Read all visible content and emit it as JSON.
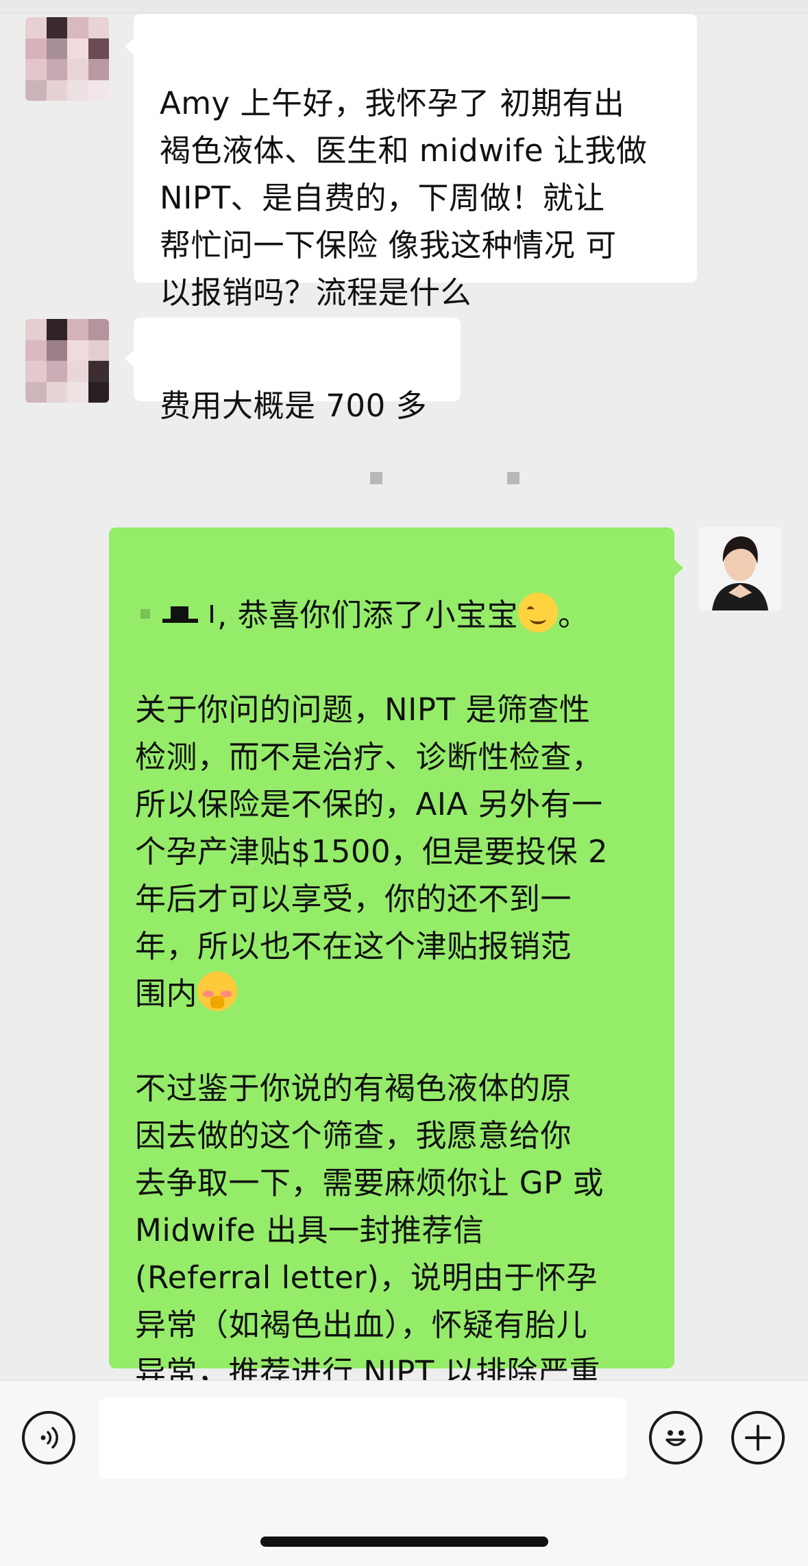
{
  "chat": {
    "messages": [
      {
        "sender": "other",
        "text": "Amy 上午好，我怀孕了 初期有出\n褐色液体、医生和 midwife 让我做\nNIPT、是自费的，下周做！就让\n帮忙问一下保险 像我这种情况 可\n以报销吗？流程是什么"
      },
      {
        "sender": "other",
        "text": "费用大概是 700 多"
      },
      {
        "sender": "self",
        "lead_text": ", 恭喜你们添了小宝宝",
        "lead_emoji": "smiling-face-emoji",
        "lead_end": "。",
        "body_text_1": "关于你问的问题，NIPT 是筛查性\n检测，而不是治疗、诊断性检查，\n所以保险是不保的，AIA 另外有一\n个孕产津贴$1500，但是要投保 2\n年后才可以享受，你的还不到一\n年，所以也不在这个津贴报销范\n围内",
        "body_emoji": "shy-face-emoji",
        "body_text_2": "不过鉴于你说的有褐色液体的原\n因去做的这个筛查，我愿意给你\n去争取一下，需要麻烦你让 GP 或\nMidwife 出具一封推荐信\n(Referral letter)，说明由于怀孕\n异常（如褐色出血），怀疑有胎儿\n异常，推荐进行 NIPT 以排除严重\n疾病。然后还有 NIPT 报价一同发\n给我"
      }
    ]
  },
  "input_bar": {
    "voice_button_icon": "voice-icon",
    "emoji_button_icon": "emoji-icon",
    "more_button_icon": "plus-icon",
    "input_value": ""
  },
  "colors": {
    "background": "#ededed",
    "incoming_bubble": "#ffffff",
    "outgoing_bubble": "#95ec69"
  }
}
